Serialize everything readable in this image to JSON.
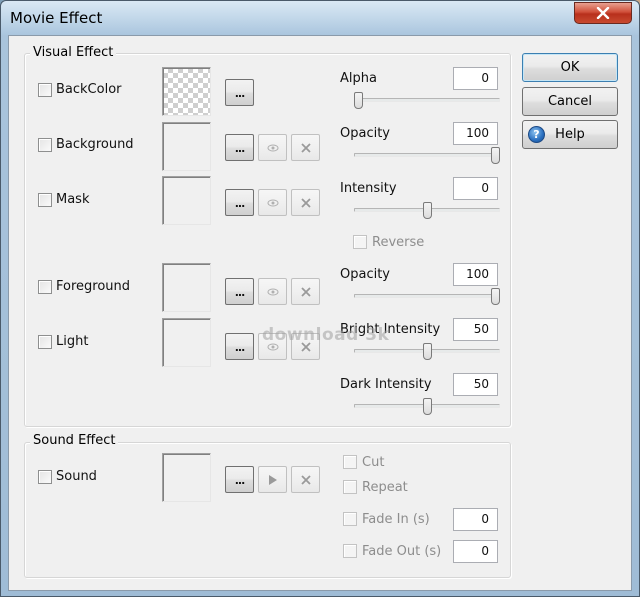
{
  "window": {
    "title": "Movie Effect"
  },
  "colors": {
    "title_bar_top": "#c4d8ea",
    "close_button": "#c84a30",
    "client_background": "#f0f0f0",
    "default_button_border": "#3c7fb1"
  },
  "icons": {
    "close": "close-x-icon",
    "more": "ellipsis-icon",
    "preview": "eye-icon",
    "clear": "clear-x-icon",
    "play": "play-icon",
    "help": "question-icon"
  },
  "visual_effect": {
    "title": "Visual Effect",
    "rows": [
      {
        "id": "backcolor",
        "label": "BackColor",
        "checked": false,
        "has_preview": false,
        "has_clear": false
      },
      {
        "id": "background",
        "label": "Background",
        "checked": false,
        "has_preview": true,
        "has_clear": true
      },
      {
        "id": "mask",
        "label": "Mask",
        "checked": false,
        "has_preview": true,
        "has_clear": true
      },
      {
        "id": "foreground",
        "label": "Foreground",
        "checked": false,
        "has_preview": true,
        "has_clear": true
      },
      {
        "id": "light",
        "label": "Light",
        "checked": false,
        "has_preview": true,
        "has_clear": true
      }
    ],
    "params": {
      "alpha": {
        "label": "Alpha",
        "value": "0",
        "level": 0.0
      },
      "opacity_bg": {
        "label": "Opacity",
        "value": "100",
        "level": 1.0
      },
      "intensity": {
        "label": "Intensity",
        "value": "0",
        "level": 0.5
      },
      "reverse": {
        "label": "Reverse",
        "checked": false,
        "enabled": false
      },
      "opacity_fg": {
        "label": "Opacity",
        "value": "100",
        "level": 1.0
      },
      "bright_intensity": {
        "label": "Bright Intensity",
        "value": "50",
        "level": 0.5
      },
      "dark_intensity": {
        "label": "Dark Intensity",
        "value": "50",
        "level": 0.5
      }
    }
  },
  "sound_effect": {
    "title": "Sound Effect",
    "sound": {
      "label": "Sound",
      "checked": false
    },
    "cut": {
      "label": "Cut",
      "checked": false,
      "enabled": false
    },
    "repeat": {
      "label": "Repeat",
      "checked": false,
      "enabled": false
    },
    "fade_in": {
      "label": "Fade In (s)",
      "value": "0",
      "checked": false,
      "enabled": false
    },
    "fade_out": {
      "label": "Fade Out (s)",
      "value": "0",
      "checked": false,
      "enabled": false
    }
  },
  "buttons": {
    "ok": "OK",
    "cancel": "Cancel",
    "help": "Help",
    "more_label": "..."
  },
  "watermark": {
    "text": "download 3k"
  }
}
